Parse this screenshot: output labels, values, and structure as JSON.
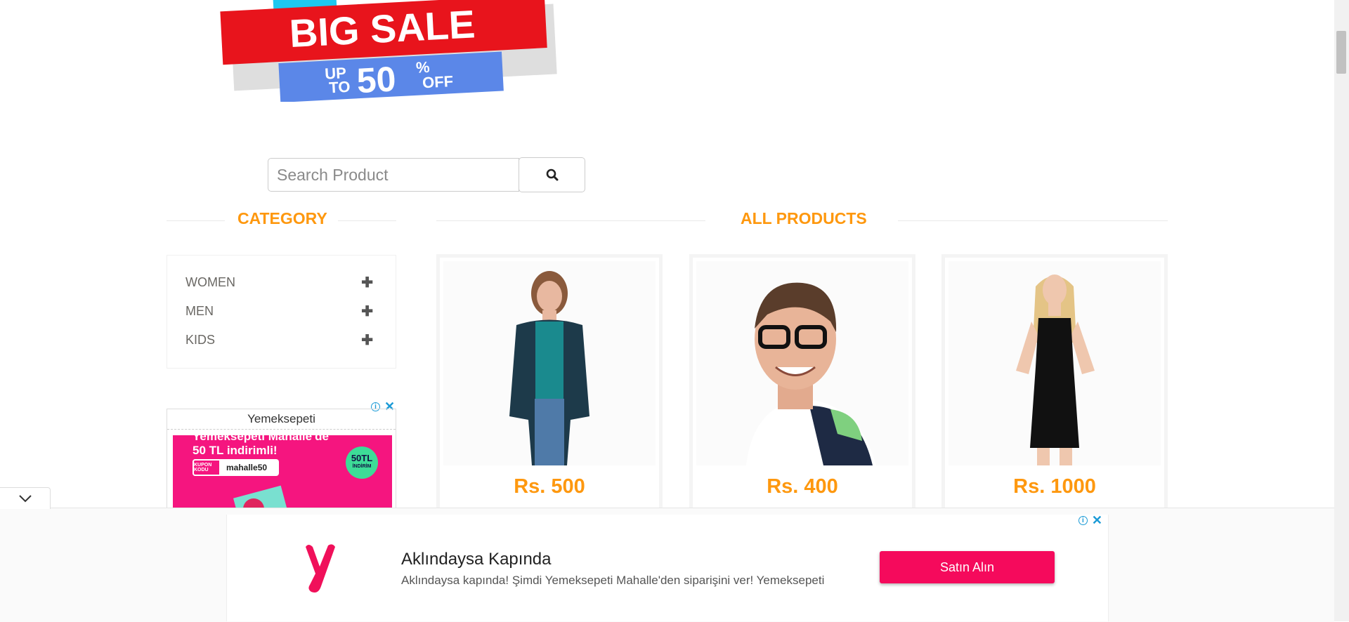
{
  "banner": {
    "headline": "BIG SALE",
    "up_to_line1": "UP",
    "up_to_line2": "TO",
    "discount": "50",
    "percent": "%",
    "off": "OFF"
  },
  "search": {
    "placeholder": "Search Product"
  },
  "sections": {
    "category_title": "CATEGORY",
    "products_title": "ALL PRODUCTS"
  },
  "categories": [
    {
      "label": "WOMEN"
    },
    {
      "label": "MEN"
    },
    {
      "label": "KIDS"
    }
  ],
  "side_ad": {
    "advertiser": "Yemeksepeti",
    "headline_line1": "Yemeksepeti Mahalle'de",
    "headline_line2": "50 TL indirimli!",
    "coupon_label": "KUPON KODU",
    "coupon_code": "mahalle50",
    "badge_amount": "50TL",
    "badge_text": "İNDİRİM"
  },
  "products": [
    {
      "price": "Rs. 500",
      "image": "woman-casual"
    },
    {
      "price": "Rs. 400",
      "image": "man-glasses"
    },
    {
      "price": "Rs. 1000",
      "image": "woman-black-dress"
    }
  ],
  "bottom_ad": {
    "title": "Aklındaysa Kapında",
    "description": "Aklındaysa kapında! Şimdi Yemeksepeti Mahalle'den siparişini ver! Yemeksepeti",
    "button": "Satın Alın"
  },
  "colors": {
    "accent": "#fe980f",
    "ad_pink": "#f5157f",
    "ad_button": "#f50a5c",
    "info_blue": "#1a9ad6"
  }
}
